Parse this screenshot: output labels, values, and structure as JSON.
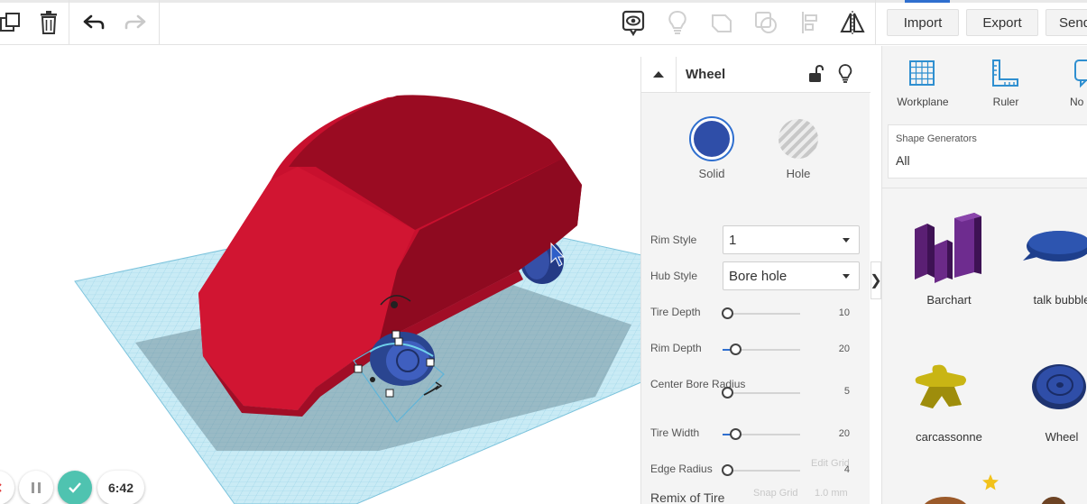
{
  "toolbar": {
    "import_label": "Import",
    "export_label": "Export",
    "send_label": "Send"
  },
  "inspector": {
    "title": "Wheel",
    "solid_label": "Solid",
    "hole_label": "Hole",
    "solid_color": "#2f4ea8",
    "properties": {
      "rim_style": {
        "label": "Rim Style",
        "value": "1"
      },
      "hub_style": {
        "label": "Hub Style",
        "value": "Bore hole"
      },
      "tire_depth": {
        "label": "Tire Depth",
        "value": "10",
        "fraction": 0.0
      },
      "rim_depth": {
        "label": "Rim Depth",
        "value": "20",
        "fraction": 0.1
      },
      "center_bore_radius": {
        "label": "Center Bore Radius",
        "value": "5",
        "fraction": 0.0
      },
      "tire_width": {
        "label": "Tire Width",
        "value": "20",
        "fraction": 0.1
      },
      "edge_radius": {
        "label": "Edge Radius",
        "value": "4",
        "fraction": 0.0
      }
    },
    "remix_label": "Remix of Tire",
    "edit_grid_label": "Edit Grid",
    "snap_grid_label": "Snap Grid",
    "snap_grid_value": "1.0 mm"
  },
  "sidebar": {
    "workplane_label": "Workplane",
    "ruler_label": "Ruler",
    "notes_label": "No",
    "shape_generators_title": "Shape Generators",
    "shape_generators_value": "All",
    "shapes": [
      "Barchart",
      "talk bubble",
      "carcassonne",
      "Wheel"
    ]
  },
  "sim": {
    "timer": "6:42"
  },
  "colors": {
    "car_body": "#c8102e",
    "wheel": "#2f4ea8",
    "workplane": "#a9dcee",
    "accent": "#2f6fcf",
    "play_button": "#4fc3b0"
  }
}
